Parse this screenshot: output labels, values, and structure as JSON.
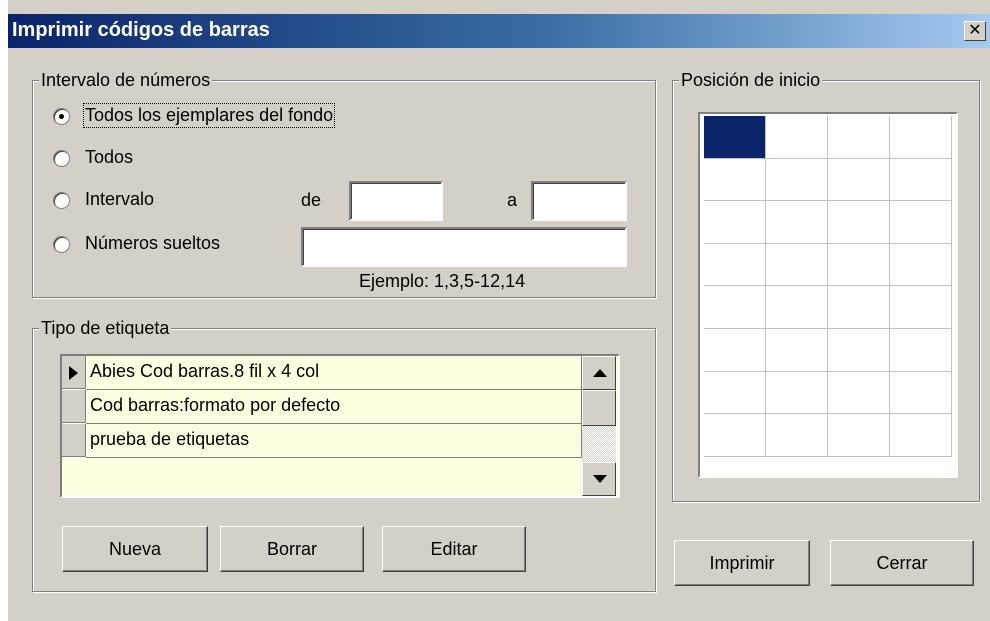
{
  "window": {
    "title": "Imprimir códigos de barras",
    "close_glyph": "✕"
  },
  "range_group": {
    "legend": "Intervalo de números",
    "options": [
      {
        "label": "Todos los ejemplares del fondo",
        "selected": true
      },
      {
        "label": "Todos",
        "selected": false
      },
      {
        "label": "Intervalo",
        "selected": false
      },
      {
        "label": "Números sueltos",
        "selected": false
      }
    ],
    "from_label": "de",
    "to_label": "a",
    "from_value": "",
    "to_value": "",
    "loose_numbers_value": "",
    "example_text": "Ejemplo: 1,3,5-12,14"
  },
  "label_group": {
    "legend": "Tipo de etiqueta",
    "rows": [
      {
        "label": "Abies Cod barras.8 fil x 4 col",
        "current": true
      },
      {
        "label": "Cod barras:formato por defecto",
        "current": false
      },
      {
        "label": "prueba de etiquetas",
        "current": false
      }
    ],
    "buttons": {
      "new": "Nueva",
      "delete": "Borrar",
      "edit": "Editar"
    }
  },
  "start_position": {
    "legend": "Posición de inicio",
    "rows": 8,
    "cols": 4,
    "selected_row": 1,
    "selected_col": 1
  },
  "footer": {
    "print": "Imprimir",
    "close": "Cerrar"
  },
  "colors": {
    "title_start": "#0a246a",
    "title_end": "#a6caf0",
    "face": "#d4d0c8",
    "grid_bg": "#ffffe1",
    "selection": "#0a246a"
  }
}
